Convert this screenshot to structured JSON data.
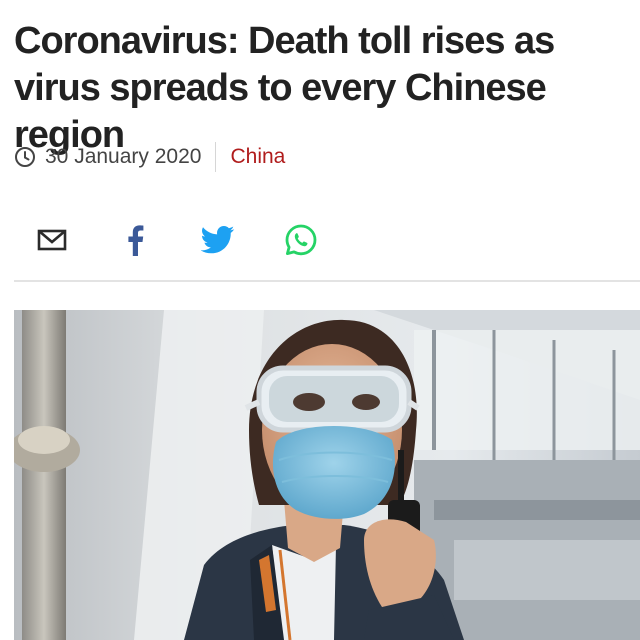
{
  "article": {
    "headline": "Coronavirus: Death toll rises as virus spreads to every Chinese region",
    "date": "30 January 2020",
    "category": "China"
  },
  "share": {
    "buttons": [
      {
        "name": "email",
        "icon": "mail-icon",
        "color": "#2b2b2b"
      },
      {
        "name": "facebook",
        "icon": "facebook-icon",
        "color": "#3b5998"
      },
      {
        "name": "twitter",
        "icon": "twitter-icon",
        "color": "#1da1f2"
      },
      {
        "name": "whatsapp",
        "icon": "whatsapp-icon",
        "color": "#25d366"
      }
    ]
  },
  "colors": {
    "category": "#b01c1c",
    "headline": "#222222"
  }
}
